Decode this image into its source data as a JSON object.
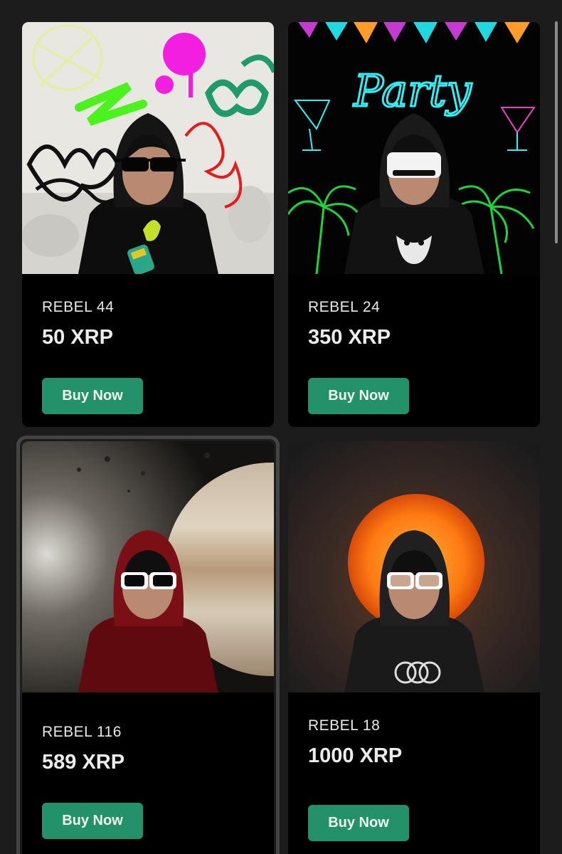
{
  "colors": {
    "background": "#1c1c1c",
    "card": "#000000",
    "buy_button": "#23926a"
  },
  "cards": [
    {
      "name": "REBEL 44",
      "price": "50 XRP",
      "button": "Buy Now",
      "image": "rebel-44-graffiti-art"
    },
    {
      "name": "REBEL 24",
      "price": "350 XRP",
      "button": "Buy Now",
      "image": "rebel-24-party-art",
      "art_text": "Party"
    },
    {
      "name": "REBEL 116",
      "price": "589 XRP",
      "button": "Buy Now",
      "image": "rebel-116-space-art"
    },
    {
      "name": "REBEL 18",
      "price": "1000 XRP",
      "button": "Buy Now",
      "image": "rebel-18-sun-bitcoin-art"
    }
  ]
}
